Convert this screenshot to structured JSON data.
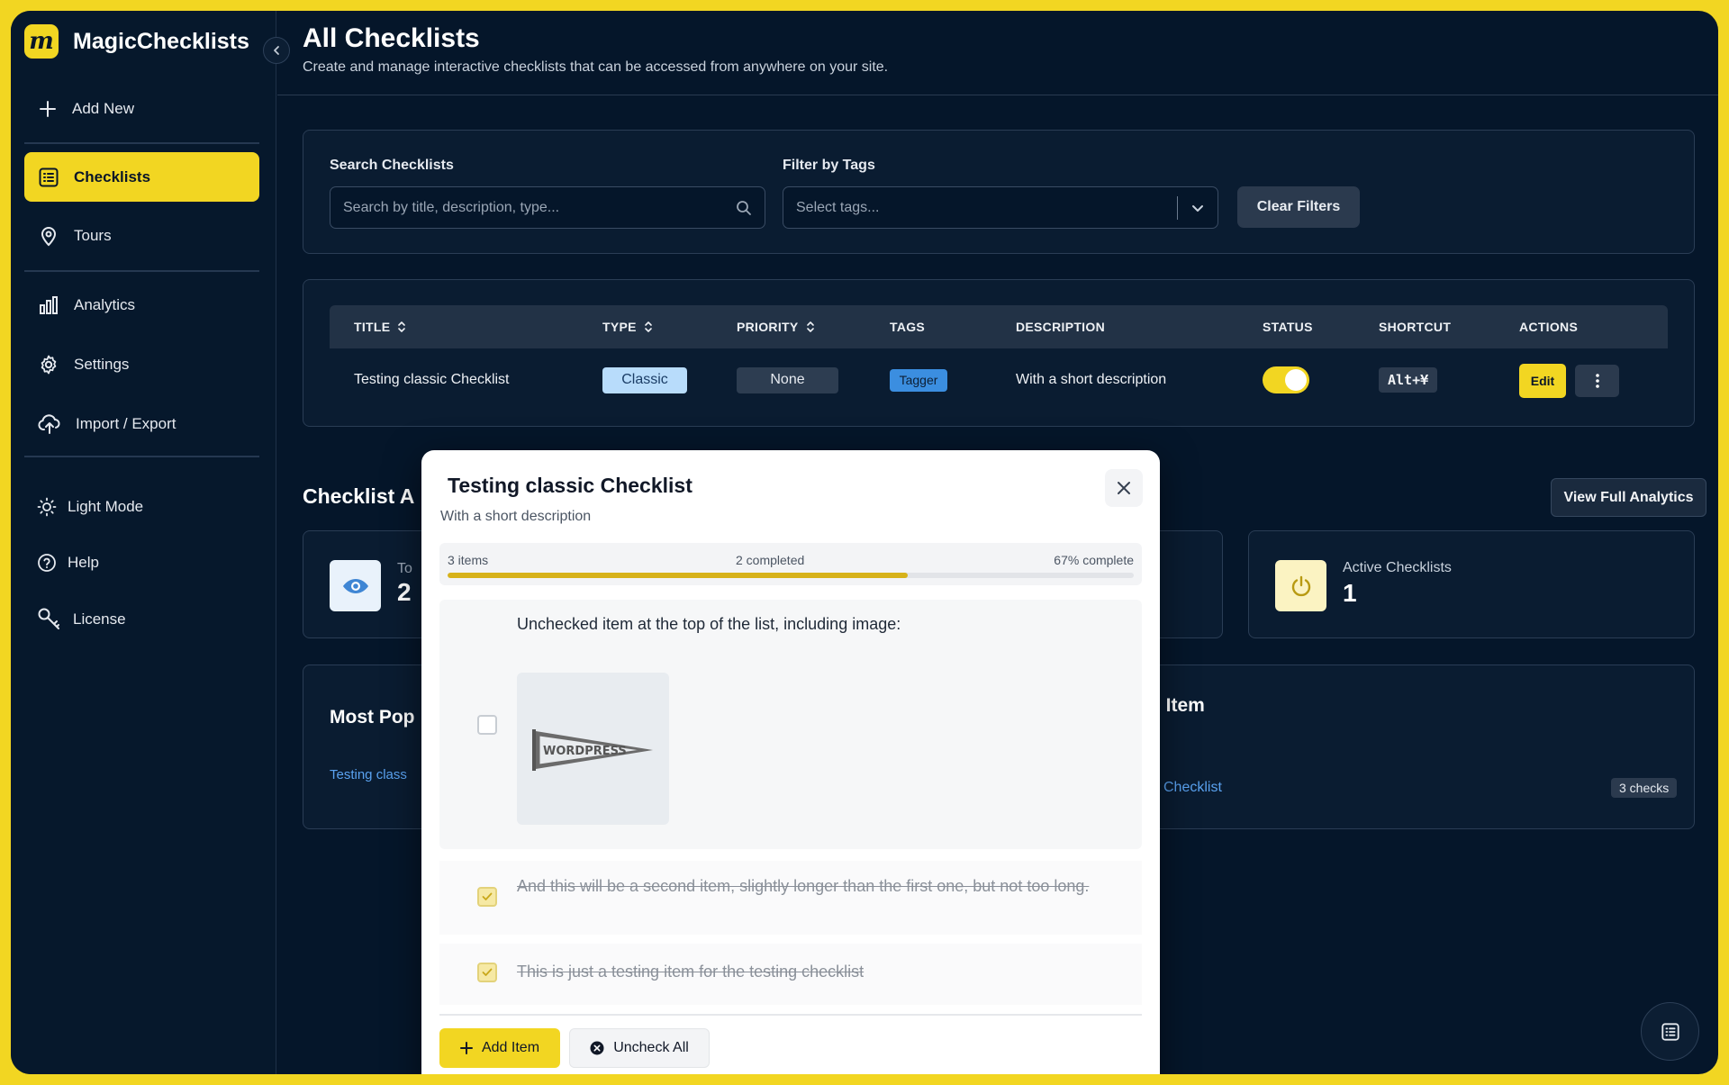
{
  "brand": {
    "name": "MagicChecklists",
    "logo_letter": "m"
  },
  "sidebar": {
    "add_new": "Add New",
    "items": [
      {
        "label": "Checklists",
        "icon": "list-icon",
        "active": true
      },
      {
        "label": "Tours",
        "icon": "map-pin-icon",
        "active": false
      },
      {
        "label": "Analytics",
        "icon": "bar-chart-icon",
        "active": false
      },
      {
        "label": "Settings",
        "icon": "gear-icon",
        "active": false
      },
      {
        "label": "Import / Export",
        "icon": "cloud-upload-icon",
        "active": false
      }
    ],
    "footer": [
      {
        "label": "Light Mode",
        "icon": "sun-icon"
      },
      {
        "label": "Help",
        "icon": "help-circle-icon"
      },
      {
        "label": "License",
        "icon": "key-icon"
      }
    ]
  },
  "page": {
    "title": "All Checklists",
    "subtitle": "Create and manage interactive checklists that can be accessed from anywhere on your site."
  },
  "filters": {
    "search_label": "Search Checklists",
    "search_placeholder": "Search by title, description, type...",
    "tags_label": "Filter by Tags",
    "tags_placeholder": "Select tags...",
    "clear_label": "Clear Filters"
  },
  "table": {
    "headers": {
      "title": "TITLE",
      "type": "TYPE",
      "priority": "PRIORITY",
      "tags": "TAGS",
      "description": "DESCRIPTION",
      "status": "STATUS",
      "shortcut": "SHORTCUT",
      "actions": "ACTIONS"
    },
    "rows": [
      {
        "title": "Testing classic Checklist",
        "type": "Classic",
        "priority": "None",
        "tag": "Tagger",
        "description": "With a short description",
        "status_on": true,
        "shortcut": "Alt+¥",
        "edit_label": "Edit"
      }
    ]
  },
  "analytics": {
    "section_title": "Checklist A",
    "view_full": "View Full Analytics",
    "stat1_label": "To",
    "stat1_value": "2",
    "active_label": "Active Checklists",
    "active_value": "1",
    "popular_title": "Most Pop",
    "popular_link": "Testing class",
    "completed_title": "d Item",
    "completed_link": "Checklist",
    "completed_badge": "3 checks"
  },
  "modal": {
    "title": "Testing classic Checklist",
    "subtitle": "With a short description",
    "progress": {
      "items_text": "3 items",
      "completed_text": "2 completed",
      "percent_text": "67% complete",
      "fraction": 0.67
    },
    "items": [
      {
        "text": "Unchecked item at the top of the list, including image:",
        "checked": false,
        "image_text": "WORDPRESS"
      },
      {
        "text": "And this will be a second item, slightly longer than the first one, but not too long.",
        "checked": true
      },
      {
        "text": "This is just a testing item for the testing checklist",
        "checked": true
      }
    ],
    "add_item": "Add Item",
    "uncheck_all": "Uncheck All"
  },
  "colors": {
    "accent": "#f2d622",
    "background": "#05162a",
    "link": "#5aa2f0",
    "tag": "#3b8ee0",
    "classic_pill": "#b8dcfb"
  }
}
